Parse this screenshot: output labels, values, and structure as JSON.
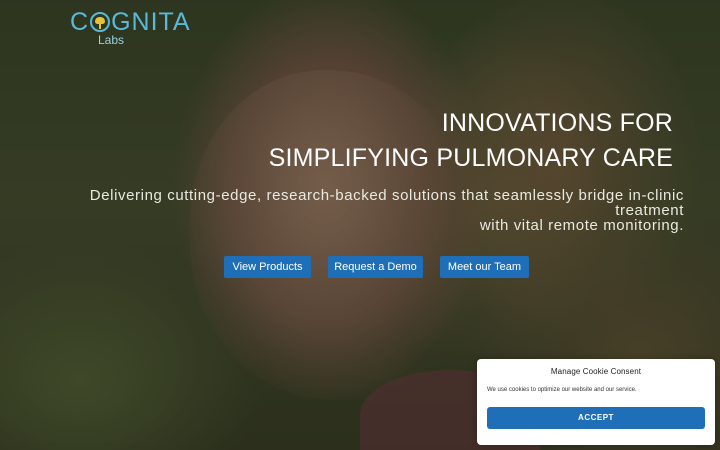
{
  "brand": {
    "name_prefix": "C",
    "name_suffix": "GNITA",
    "sub": "Labs",
    "icon": "brain-icon",
    "colors": {
      "primary": "#58b9d8",
      "accent": "#e3c23a"
    }
  },
  "hero": {
    "headline_line1": "INNOVATIONS FOR",
    "headline_line2": "SIMPLIFYING PULMONARY CARE",
    "tagline_line1": "Delivering cutting-edge, research-backed solutions that seamlessly bridge in-clinic treatment",
    "tagline_line2": "with vital remote monitoring."
  },
  "actions": {
    "view_products": "View Products",
    "request_demo": "Request a Demo",
    "meet_team": "Meet our Team",
    "button_color": "#1f6fb8"
  },
  "cookie": {
    "title": "Manage Cookie Consent",
    "text": "We use cookies to optimize our website and our service.",
    "accept": "ACCEPT"
  }
}
